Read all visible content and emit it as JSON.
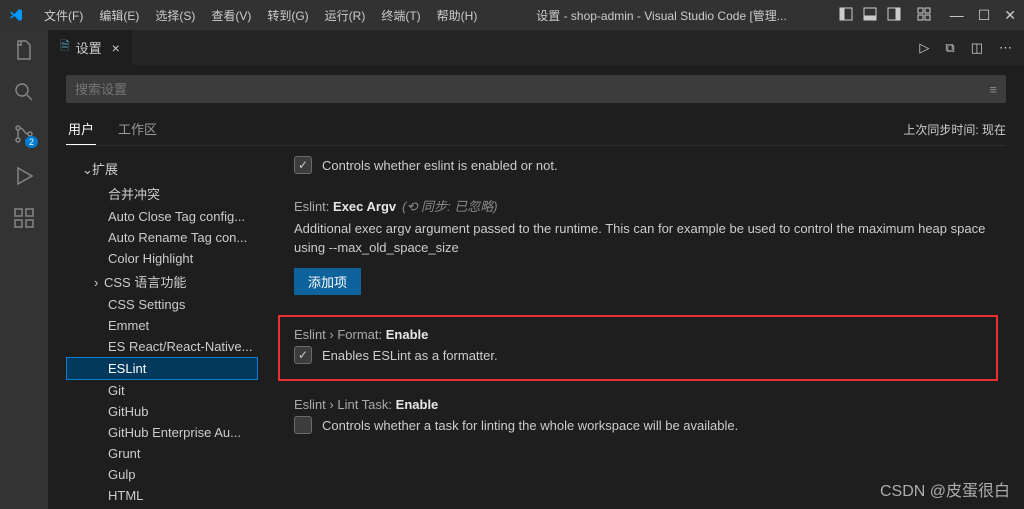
{
  "menu": {
    "file": "文件(F)",
    "edit": "编辑(E)",
    "select": "选择(S)",
    "view": "查看(V)",
    "go": "转到(G)",
    "run": "运行(R)",
    "terminal": "终端(T)",
    "help": "帮助(H)"
  },
  "window_title": "设置 - shop-admin - Visual Studio Code [管理...",
  "tab": {
    "label": "设置"
  },
  "search": {
    "placeholder": "搜索设置"
  },
  "scope": {
    "user": "用户",
    "workspace": "工作区"
  },
  "sync": "上次同步时间: 现在",
  "activity_badge": "2",
  "toc": {
    "ext": "扩展",
    "items": [
      "合并冲突",
      "Auto Close Tag config...",
      "Auto Rename Tag con...",
      "Color Highlight",
      "CSS 语言功能",
      "CSS Settings",
      "Emmet",
      "ES React/React-Native...",
      "ESLint",
      "Git",
      "GitHub",
      "GitHub Enterprise Au...",
      "Grunt",
      "Gulp",
      "HTML"
    ]
  },
  "settings": {
    "enable_desc": "Controls whether eslint is enabled or not.",
    "exec": {
      "title_scope": "Eslint:",
      "title_key": "Exec Argv",
      "sync_note": "(⟲ 同步: 已忽略)",
      "desc": "Additional exec argv argument passed to the runtime. This can for example be used to control the maximum heap space using --max_old_space_size",
      "add_btn": "添加项"
    },
    "format": {
      "title_scope": "Eslint › Format:",
      "title_key": "Enable",
      "desc": "Enables ESLint as a formatter."
    },
    "lint": {
      "title_scope": "Eslint › Lint Task:",
      "title_key": "Enable",
      "desc": "Controls whether a task for linting the whole workspace will be available."
    }
  },
  "watermark": "CSDN @皮蛋很白"
}
